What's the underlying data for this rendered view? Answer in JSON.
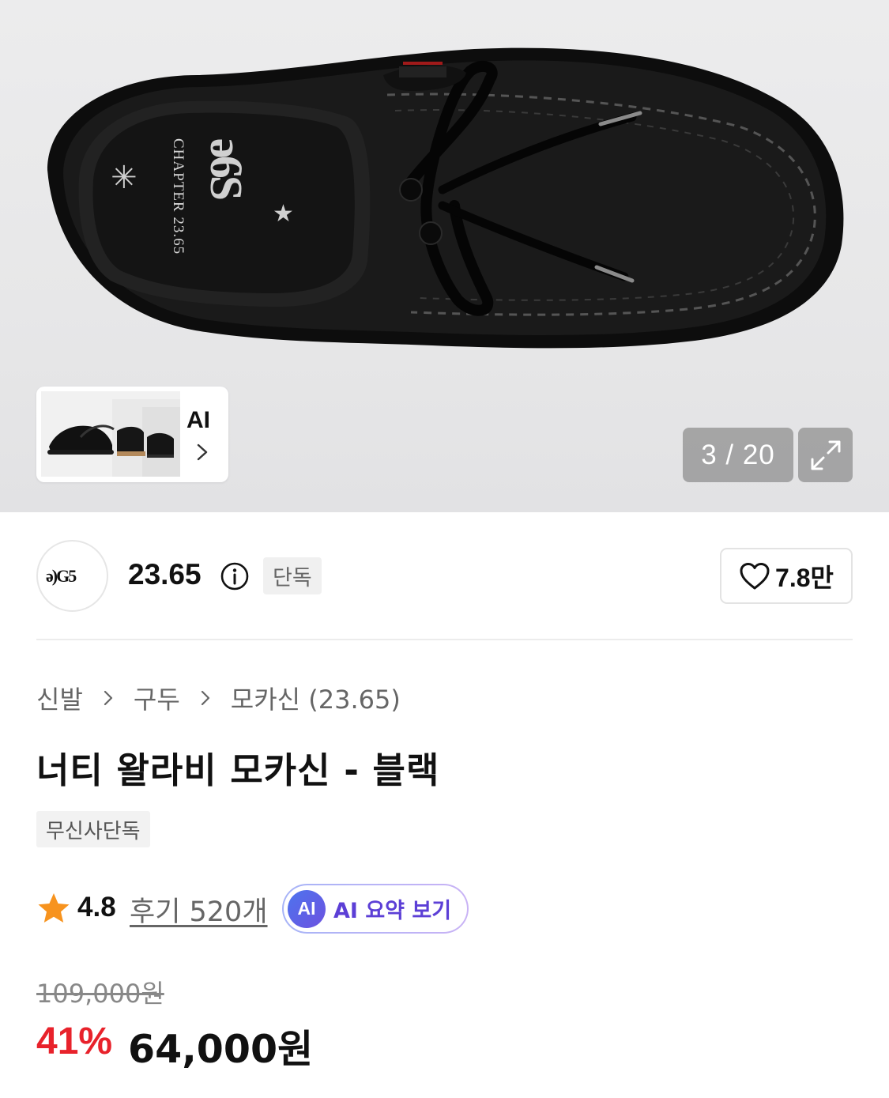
{
  "gallery": {
    "counter": "3 / 20",
    "insole_brand": "CHAPTER 23.65",
    "thumbnail_ai_label": "AI"
  },
  "brand": {
    "name": "23.65",
    "exclusive_tag": "단독",
    "like_count": "7.8만"
  },
  "breadcrumb": {
    "items": [
      "신발",
      "구두",
      "모카신 (23.65)"
    ]
  },
  "product": {
    "title": "너티 왈라비 모카신 - 블랙",
    "badge": "무신사단독"
  },
  "rating": {
    "value": "4.8",
    "review_link": "후기 520개",
    "ai_badge": "AI",
    "ai_summary_label": "AI 요약 보기"
  },
  "price": {
    "original": "109,000원",
    "discount": "41%",
    "sale": "64,000원"
  },
  "colors": {
    "discount_red": "#e8222b",
    "star_orange": "#f7931e",
    "ai_purple": "#5c3fd6"
  },
  "icons": [
    "expand-icon",
    "chevron-right-icon",
    "info-icon",
    "heart-icon",
    "star-icon"
  ]
}
